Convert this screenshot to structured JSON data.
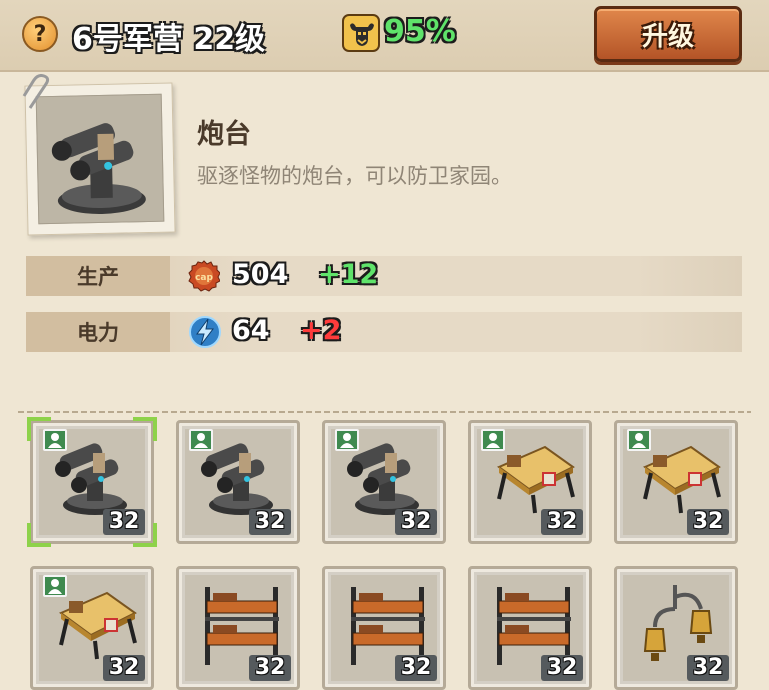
{
  "header": {
    "help_glyph": "?",
    "title": "6号军营 22级",
    "morale_icon": "bull-head-icon",
    "morale_percent": "95%",
    "upgrade_label": "升级"
  },
  "building": {
    "name": "炮台",
    "description": "驱逐怪物的炮台，可以防卫家园。",
    "image_icon": "turret-icon"
  },
  "stats": [
    {
      "label": "生产",
      "icon": "bottle-cap-icon",
      "value": "504",
      "delta": "+12",
      "delta_color": "#5fe36a"
    },
    {
      "label": "电力",
      "icon": "lightning-icon",
      "value": "64",
      "delta": "+2",
      "delta_color": "#ff3b3b"
    }
  ],
  "slots": [
    {
      "type": "turret",
      "level": "32",
      "assigned": true,
      "selected": true
    },
    {
      "type": "turret",
      "level": "32",
      "assigned": true,
      "selected": false
    },
    {
      "type": "turret",
      "level": "32",
      "assigned": true,
      "selected": false
    },
    {
      "type": "workbench",
      "level": "32",
      "assigned": true,
      "selected": false
    },
    {
      "type": "workbench",
      "level": "32",
      "assigned": true,
      "selected": false
    },
    {
      "type": "workbench",
      "level": "32",
      "assigned": true,
      "selected": false
    },
    {
      "type": "bunk-bed",
      "level": "32",
      "assigned": false,
      "selected": false
    },
    {
      "type": "bunk-bed",
      "level": "32",
      "assigned": false,
      "selected": false
    },
    {
      "type": "bunk-bed",
      "level": "32",
      "assigned": false,
      "selected": false
    },
    {
      "type": "lantern",
      "level": "32",
      "assigned": false,
      "selected": false
    }
  ],
  "colors": {
    "background": "#efe6d3",
    "accent_green": "#5fe36a",
    "accent_red": "#ff3b3b",
    "upgrade_button": "#c96a34",
    "selection": "#8ed24a"
  }
}
